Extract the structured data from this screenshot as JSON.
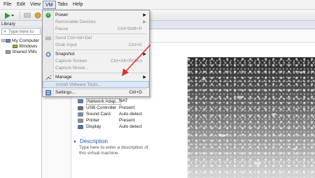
{
  "menubar": {
    "items": [
      {
        "label": "File"
      },
      {
        "label": "Edit"
      },
      {
        "label": "View"
      },
      {
        "label": "VM"
      },
      {
        "label": "Tabs"
      },
      {
        "label": "Help"
      }
    ]
  },
  "library": {
    "header": "Library",
    "search_placeholder": "Type here to",
    "tree": [
      {
        "label": "My Computer"
      },
      {
        "label": "Windows"
      },
      {
        "label": "Shared VMs"
      }
    ]
  },
  "vm_menu": {
    "items": [
      {
        "label": "Power",
        "shortcut": "",
        "disabled": false,
        "submenu": true,
        "icon": "power-icon"
      },
      {
        "label": "Removable Devices",
        "shortcut": "",
        "disabled": true,
        "submenu": true,
        "icon": ""
      },
      {
        "label": "Pause",
        "shortcut": "Ctrl+Shift+P",
        "disabled": true,
        "submenu": false,
        "icon": ""
      },
      {
        "label": "Send Ctrl+Alt+Del",
        "shortcut": "",
        "disabled": true,
        "submenu": false,
        "icon": "keyboard-icon"
      },
      {
        "label": "Grab Input",
        "shortcut": "Ctrl+G",
        "disabled": true,
        "submenu": false,
        "icon": ""
      },
      {
        "label": "Snapshot",
        "shortcut": "",
        "disabled": false,
        "submenu": true,
        "icon": "snapshot-icon"
      },
      {
        "label": "Capture Screen",
        "shortcut": "Ctrl+Alt+PrtScn",
        "disabled": true,
        "submenu": false,
        "icon": ""
      },
      {
        "label": "Capture Movie...",
        "shortcut": "",
        "disabled": true,
        "submenu": false,
        "icon": ""
      },
      {
        "label": "Manage",
        "shortcut": "",
        "disabled": false,
        "submenu": true,
        "icon": "wrench-icon"
      },
      {
        "label": "Install VMware Tools...",
        "shortcut": "",
        "disabled": true,
        "submenu": false,
        "icon": ""
      },
      {
        "label": "Settings...",
        "shortcut": "Ctrl+D",
        "disabled": false,
        "submenu": false,
        "icon": "settings-icon"
      }
    ]
  },
  "hardware": [
    {
      "name": "Network Adap...",
      "value": "NAT",
      "icon": "network-icon",
      "color": "#5a7fb0"
    },
    {
      "name": "USB Controller",
      "value": "Present",
      "icon": "usb-icon",
      "color": "#6e6e6e"
    },
    {
      "name": "Sound Card",
      "value": "Auto detect",
      "icon": "sound-icon",
      "color": "#7a8aa0"
    },
    {
      "name": "Printer",
      "value": "Present",
      "icon": "printer-icon",
      "color": "#8a8a8a"
    },
    {
      "name": "Display",
      "value": "Auto detect",
      "icon": "display-icon",
      "color": "#4f74a8"
    }
  ],
  "description": {
    "title": "Description",
    "placeholder": "Type here to enter a description of this virtual machine."
  },
  "colors": {
    "accent": "#2c5aa0",
    "arrow": "#d9342b",
    "play": "#2e9e2e"
  }
}
